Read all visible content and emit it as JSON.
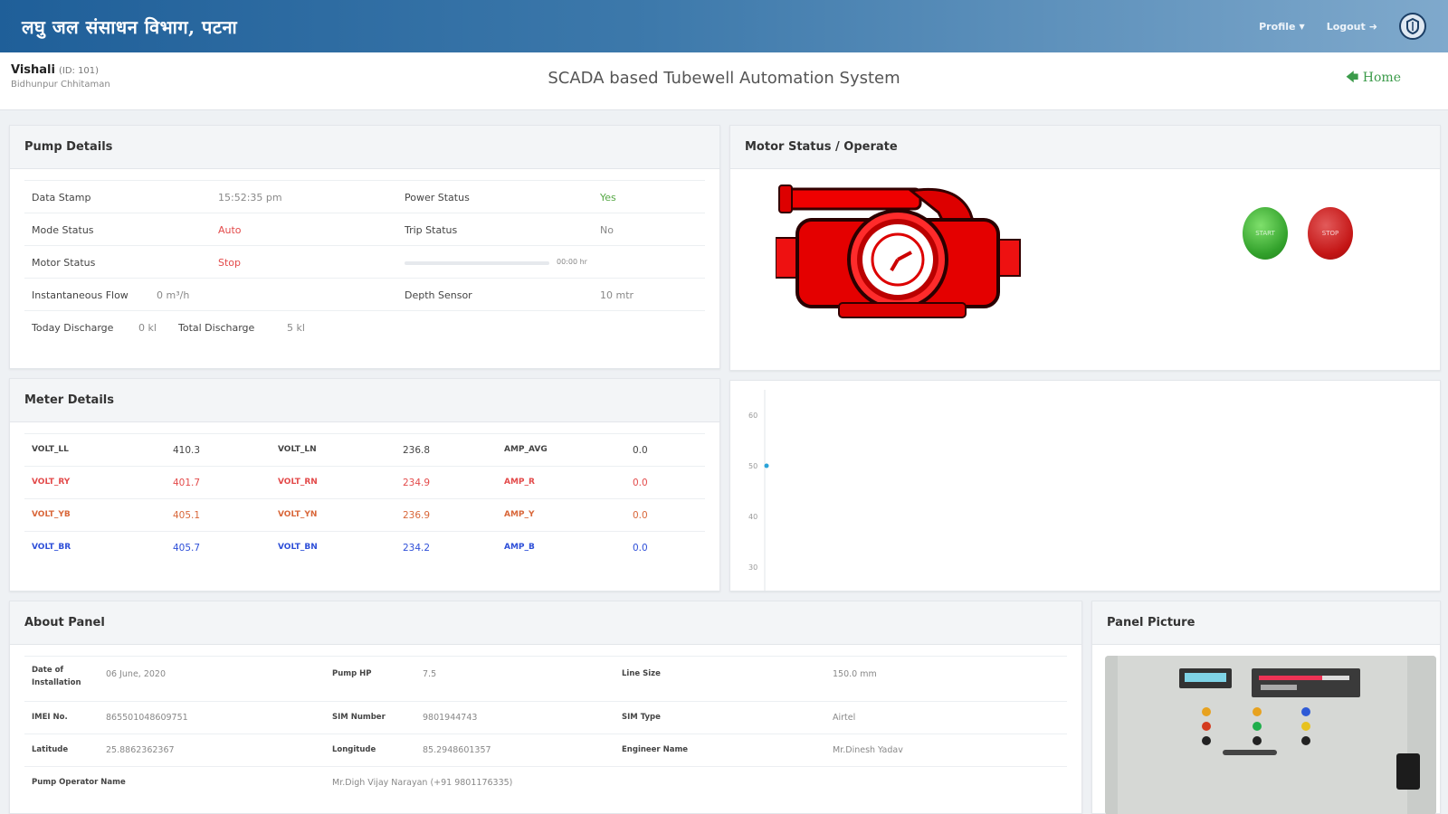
{
  "navbar": {
    "brand": "लघु जल संसाधन विभाग, पटना",
    "profile_label": "Profile",
    "logout_label": "Logout"
  },
  "site": {
    "name": "Vishali",
    "id": "(ID: 101)",
    "location": "Bidhunpur Chhitaman"
  },
  "system_title": "SCADA based Tubewell Automation System",
  "home_label": "Home",
  "pump_details": {
    "title": "Pump Details",
    "data_stamp_label": "Data Stamp",
    "data_stamp_value": "15:52:35 pm",
    "power_status_label": "Power Status",
    "power_status_value": "Yes",
    "mode_status_label": "Mode Status",
    "mode_status_value": "Auto",
    "trip_status_label": "Trip Status",
    "trip_status_value": "No",
    "motor_status_label": "Motor Status",
    "motor_status_value": "Stop",
    "progress_text": "00:00 hr",
    "progress_fraction": 0,
    "flow_label": "Instantaneous Flow",
    "flow_value": "0 m³/h",
    "depth_label": "Depth Sensor",
    "depth_value": "10 mtr",
    "today_discharge_label": "Today Discharge",
    "today_discharge_value": "0 kl",
    "total_discharge_label": "Total Discharge",
    "total_discharge_value": "5 kl"
  },
  "motor_panel": {
    "title": "Motor Status / Operate",
    "start_label": "START",
    "stop_label": "STOP"
  },
  "meter_details": {
    "title": "Meter Details",
    "rows": [
      {
        "c1": "VOLT_LL",
        "v1": "410.3",
        "c2": "VOLT_LN",
        "v2": "236.8",
        "c3": "AMP_AVG",
        "v3": "0.0"
      },
      {
        "c1": "VOLT_RY",
        "v1": "401.7",
        "c2": "VOLT_RN",
        "v2": "234.9",
        "c3": "AMP_R",
        "v3": "0.0"
      },
      {
        "c1": "VOLT_YB",
        "v1": "405.1",
        "c2": "VOLT_YN",
        "v2": "236.9",
        "c3": "AMP_Y",
        "v3": "0.0"
      },
      {
        "c1": "VOLT_BR",
        "v1": "405.7",
        "c2": "VOLT_BN",
        "v2": "234.2",
        "c3": "AMP_B",
        "v3": "0.0"
      }
    ],
    "row_colors": [
      "#444444",
      "#e34a4a",
      "#d9673a",
      "#2e4fd8"
    ]
  },
  "chart_data": {
    "type": "scatter",
    "yticks": [
      60,
      50,
      40,
      30
    ],
    "ylim": [
      25,
      65
    ],
    "points": [
      {
        "y": 50
      }
    ],
    "point_color": "#2aa3d8"
  },
  "about_panel": {
    "title": "About Panel",
    "install_label": "Date of Installation",
    "install_value": "06 June, 2020",
    "pump_hp_label": "Pump HP",
    "pump_hp_value": "7.5",
    "line_size_label": "Line Size",
    "line_size_value": "150.0 mm",
    "imei_label": "IMEI No.",
    "imei_value": "865501048609751",
    "sim_number_label": "SIM Number",
    "sim_number_value": "9801944743",
    "sim_type_label": "SIM Type",
    "sim_type_value": "Airtel",
    "latitude_label": "Latitude",
    "latitude_value": "25.8862362367",
    "longitude_label": "Longitude",
    "longitude_value": "85.2948601357",
    "engineer_label": "Engineer Name",
    "engineer_value": "Mr.Dinesh Yadav",
    "operator_label": "Pump Operator Name",
    "operator_value": "Mr.Digh Vijay Narayan (+91 9801176335)"
  },
  "panel_picture": {
    "title": "Panel Picture"
  }
}
